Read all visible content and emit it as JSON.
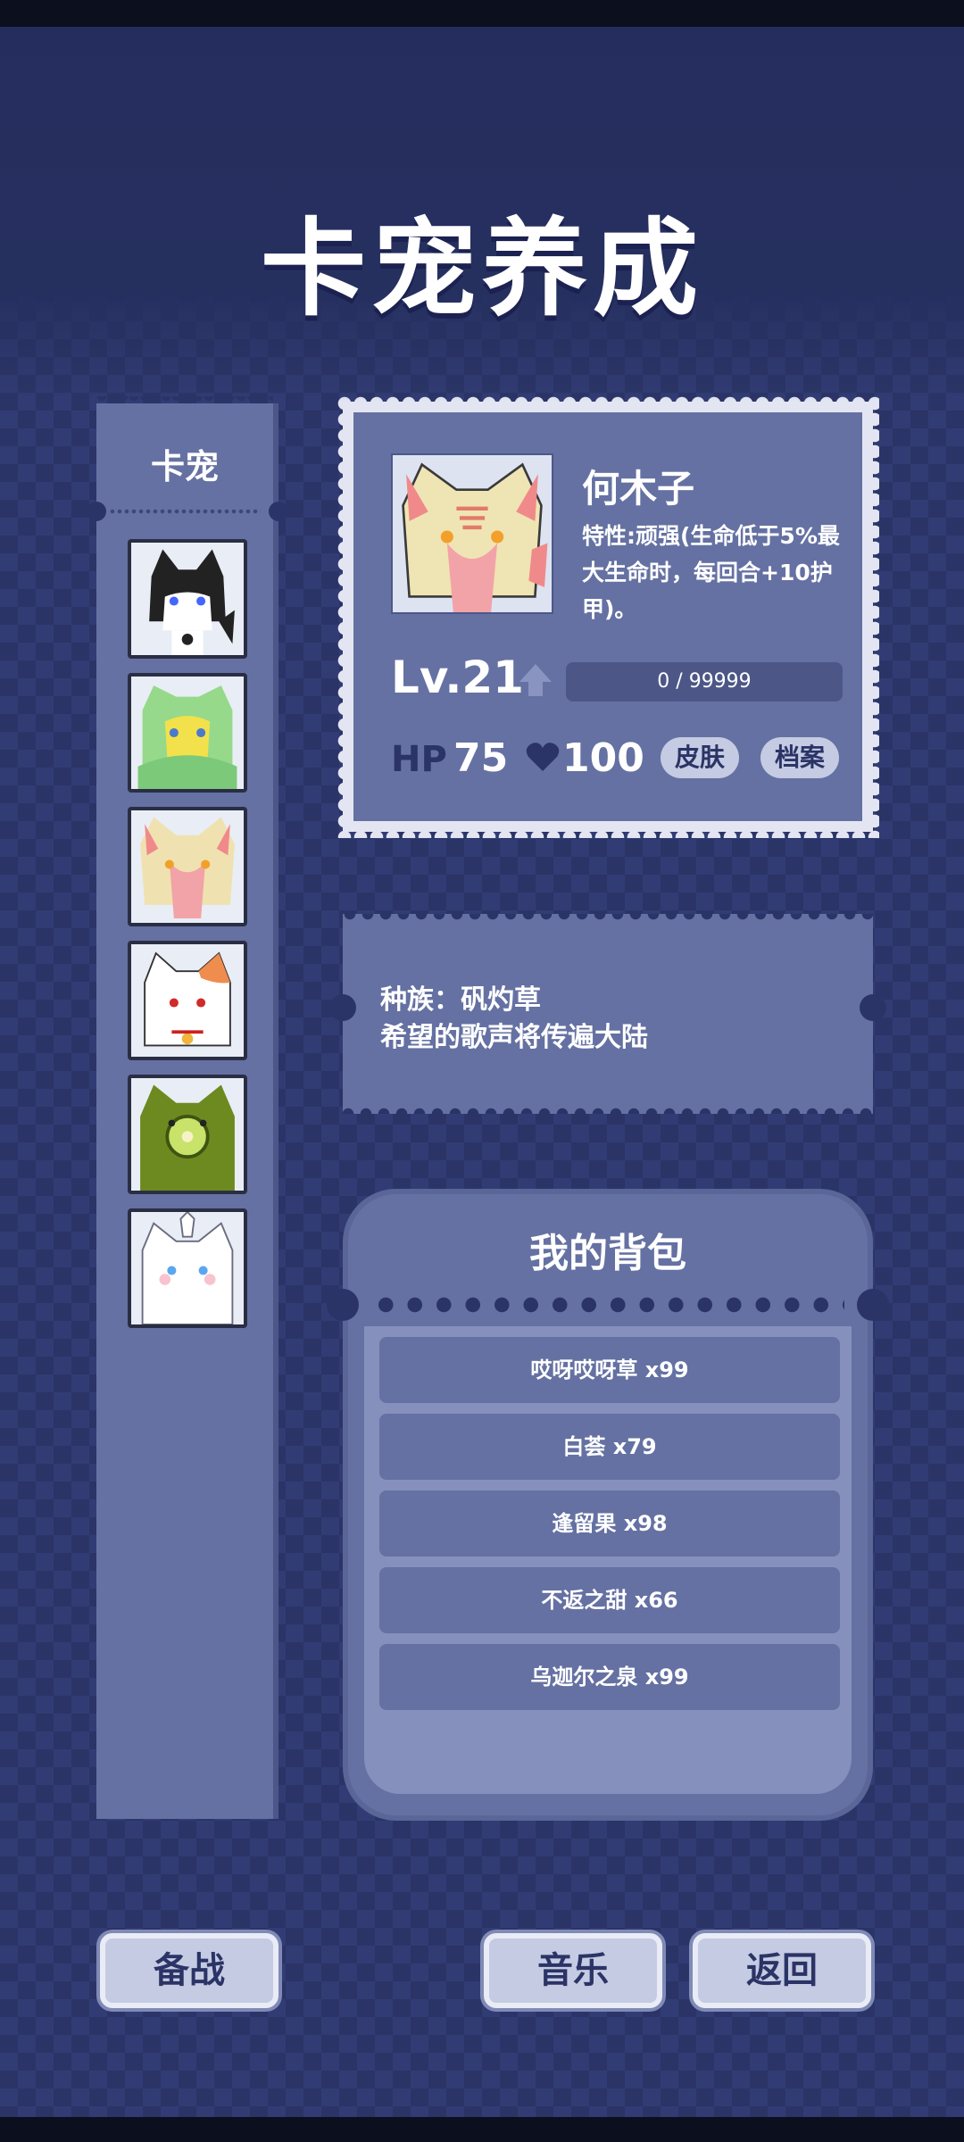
{
  "title": "卡宠养成",
  "sidebar": {
    "title": "卡宠",
    "pets": [
      {
        "icon": "black-cat-pet-icon",
        "color": "#2a2a2a"
      },
      {
        "icon": "green-yellow-pet-icon",
        "color": "#8fd37a"
      },
      {
        "icon": "pink-cream-pet-icon",
        "color": "#f2a0a0"
      },
      {
        "icon": "white-orange-cat-pet-icon",
        "color": "#ef8d4f"
      },
      {
        "icon": "kiwi-pet-icon",
        "color": "#6c8a1f"
      },
      {
        "icon": "white-blue-cat-pet-icon",
        "color": "#ffffff"
      }
    ]
  },
  "pet": {
    "name": "何木子",
    "trait": "特性:顽强(生命低于5%最大生命时，每回合+10护甲)。",
    "level": "Lv.21",
    "exp": "0 / 99999",
    "hp_label": "HP",
    "hp": "75",
    "hearts": "100",
    "skin_button": "皮肤",
    "profile_button": "档案"
  },
  "description": {
    "species": "种族：矾灼草",
    "motto": "希望的歌声将传遍大陆"
  },
  "bag": {
    "title": "我的背包",
    "items": [
      "哎呀哎呀草 x99",
      "白荟 x79",
      "逢留果 x98",
      "不返之甜 x66",
      "乌迦尔之泉 x99"
    ]
  },
  "buttons": {
    "battle": "备战",
    "music": "音乐",
    "back": "返回"
  }
}
